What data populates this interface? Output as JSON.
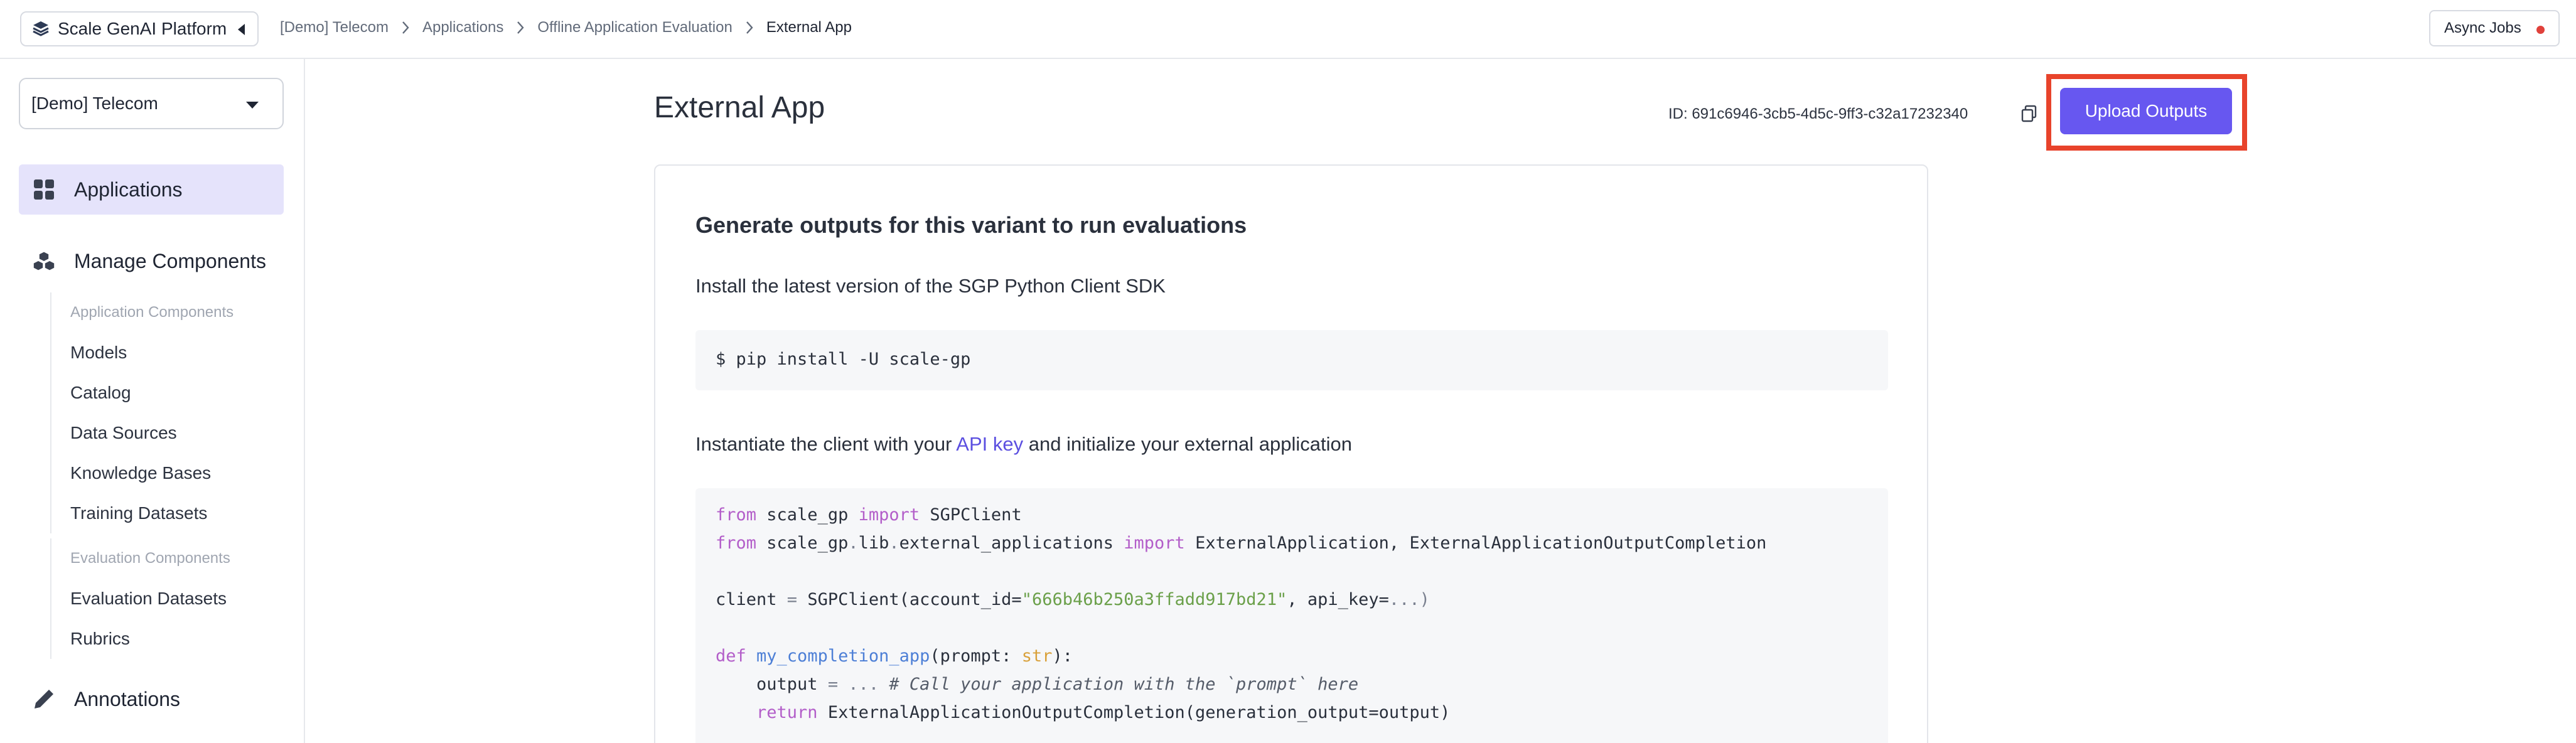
{
  "topbar": {
    "platform_label": "Scale GenAI Platform",
    "breadcrumbs": [
      "[Demo] Telecom",
      "Applications",
      "Offline Application Evaluation",
      "External App"
    ],
    "async_jobs_label": "Async Jobs",
    "async_status_color": "#e0413b"
  },
  "sidebar": {
    "org_select_value": "[Demo] Telecom",
    "nav": {
      "applications": "Applications",
      "manage_components": "Manage Components",
      "annotations": "Annotations"
    },
    "application_components_header": "Application Components",
    "application_components": [
      "Models",
      "Catalog",
      "Data Sources",
      "Knowledge Bases",
      "Training Datasets"
    ],
    "evaluation_components_header": "Evaluation Components",
    "evaluation_components": [
      "Evaluation Datasets",
      "Rubrics"
    ]
  },
  "main": {
    "title": "External App",
    "id_text": "ID: 691c6946-3cb5-4d5c-9ff3-c32a17232340",
    "upload_button": "Upload Outputs",
    "accent_color": "#6757f0",
    "highlight_color": "#e8432b",
    "card": {
      "title": "Generate outputs for this variant to run evaluations",
      "install_text": "Install the latest version of the SGP Python Client SDK",
      "install_command": "$ pip install -U scale-gp",
      "instantiate_prefix": "Instantiate the client with your",
      "api_key_link": "API key",
      "instantiate_suffix": "and initialize your external application",
      "code": {
        "line1": {
          "kw1": "from",
          "mod": " scale_gp ",
          "kw2": "import",
          "name": " SGPClient"
        },
        "line2": {
          "kw1": "from",
          "mod": " scale_gp",
          "dot1": ".",
          "lib": "lib",
          "dot2": ".",
          "ext": "external_applications ",
          "kw2": "import",
          "names": " ExternalApplication, ExternalApplicationOutputCompletion"
        },
        "line3": {
          "var": "client ",
          "eq": "=",
          "call": " SGPClient(account_id=",
          "account_id": "\"666b46b250a3ffadd917bd21\"",
          "mid": ", api_key=",
          "rest": "...)"
        },
        "line4": {
          "kw": "def",
          "fn": " my_completion_app",
          "open": "(prompt: ",
          "type": "str",
          "close": "):"
        },
        "line5": {
          "indent": "    output ",
          "eq": "=",
          "ellipsis": " ... ",
          "comment": "# Call your application with the `prompt` here"
        },
        "line6": {
          "indent": "    ",
          "kw": "return",
          "call": " ExternalApplicationOutputCompletion(generation_output=output)"
        }
      }
    }
  }
}
